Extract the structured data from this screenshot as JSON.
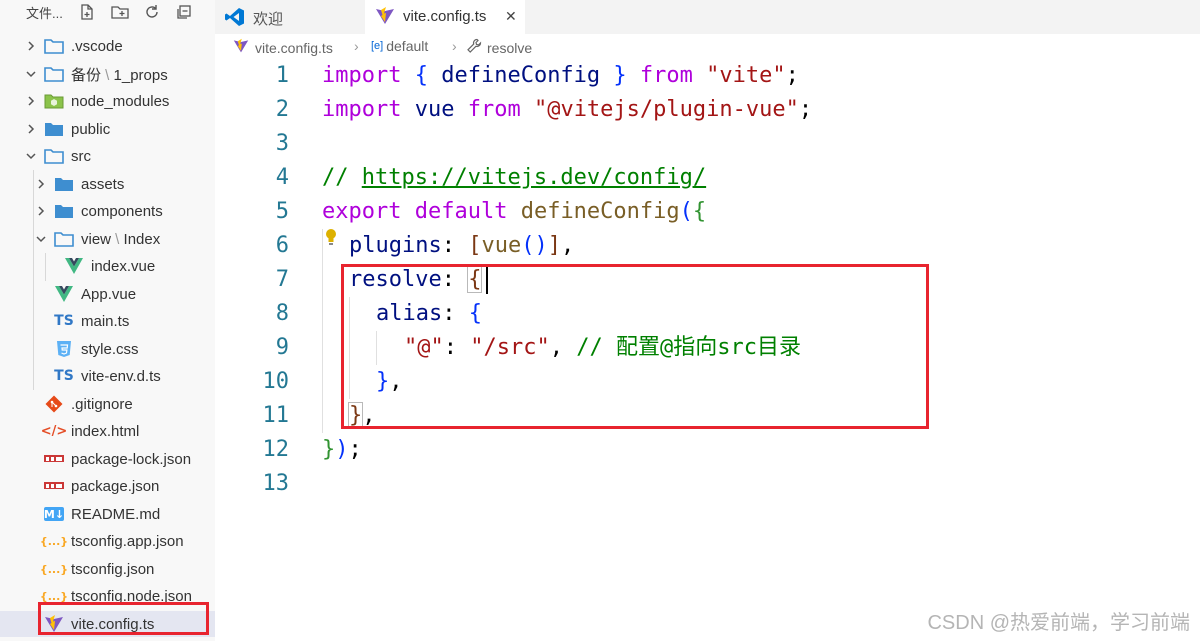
{
  "explorer": {
    "title": "文件...",
    "actions": [
      "new-file-icon",
      "new-folder-icon",
      "refresh-icon",
      "collapse-all-icon"
    ]
  },
  "tree": {
    "vscode": ".vscode",
    "backup_folder": "备份",
    "backup_sub": "1_props",
    "node_modules": "node_modules",
    "public": "public",
    "src": "src",
    "assets": "assets",
    "components": "components",
    "view_folder": "view",
    "view_sub": "Index",
    "index_vue": "index.vue",
    "app_vue": "App.vue",
    "main_ts": "main.ts",
    "style_css": "style.css",
    "vite_env": "vite-env.d.ts",
    "gitignore": ".gitignore",
    "index_html": "index.html",
    "package_lock": "package-lock.json",
    "package_json": "package.json",
    "readme": "README.md",
    "tsconfig_app": "tsconfig.app.json",
    "tsconfig": "tsconfig.json",
    "tsconfig_node": "tsconfig.node.json",
    "vite_config": "vite.config.ts"
  },
  "icon_text": {
    "ts": "TS",
    "md": "M↓",
    "json": "{...}",
    "html": "</>",
    "css": "CSS"
  },
  "tabs": {
    "welcome": "欢迎",
    "vite_config": "vite.config.ts",
    "close": "✕"
  },
  "breadcrumb": {
    "file": "vite.config.ts",
    "default": "default",
    "resolve": "resolve",
    "sep": "›",
    "default_icon": "[e]"
  },
  "code": {
    "line_numbers": [
      "1",
      "2",
      "3",
      "4",
      "5",
      "6",
      "7",
      "8",
      "9",
      "10",
      "11",
      "12",
      "13"
    ],
    "l1": {
      "import": "import",
      "open": "{",
      "name": " defineConfig ",
      "close": "}",
      "from": "from",
      "str": "\"vite\"",
      "semi": ";"
    },
    "l2": {
      "import": "import",
      "name": " vue ",
      "from": "from",
      "str": "\"@vitejs/plugin-vue\"",
      "semi": ";"
    },
    "l4": {
      "slashes": "// ",
      "url": "https://vitejs.dev/config/"
    },
    "l5": {
      "export": "export",
      "default": "default",
      "fn": "defineConfig",
      "paren": "(",
      "brace": "{"
    },
    "l6": {
      "key": "plugins",
      "colon": ": ",
      "bopen": "[",
      "fn": "vue",
      "parens": "()",
      "bclose": "]",
      "comma": ","
    },
    "l7": {
      "key": "resolve",
      "colon": ": ",
      "brace": "{"
    },
    "l8": {
      "key": "alias",
      "colon": ": ",
      "brace": "{"
    },
    "l9": {
      "str1": "\"@\"",
      "colon": ": ",
      "str2": "\"/src\"",
      "comma": ", ",
      "comment": "// 配置@指向src目录"
    },
    "l10": {
      "brace": "}",
      "comma": ","
    },
    "l11": {
      "brace": "}",
      "comma": ","
    },
    "l12": {
      "brace": "}",
      "paren": ")",
      "semi": ";"
    }
  },
  "watermark": "CSDN @热爱前端，学习前端",
  "colors": {
    "vue_green": "#41b883",
    "vue_dark": "#35495e",
    "ts_blue": "#3178c6",
    "vite_purple": "#7e57c2",
    "vite_yellow": "#ffc107",
    "highlight_red": "#e8242f",
    "folder_blue": "#3e8ed0"
  }
}
